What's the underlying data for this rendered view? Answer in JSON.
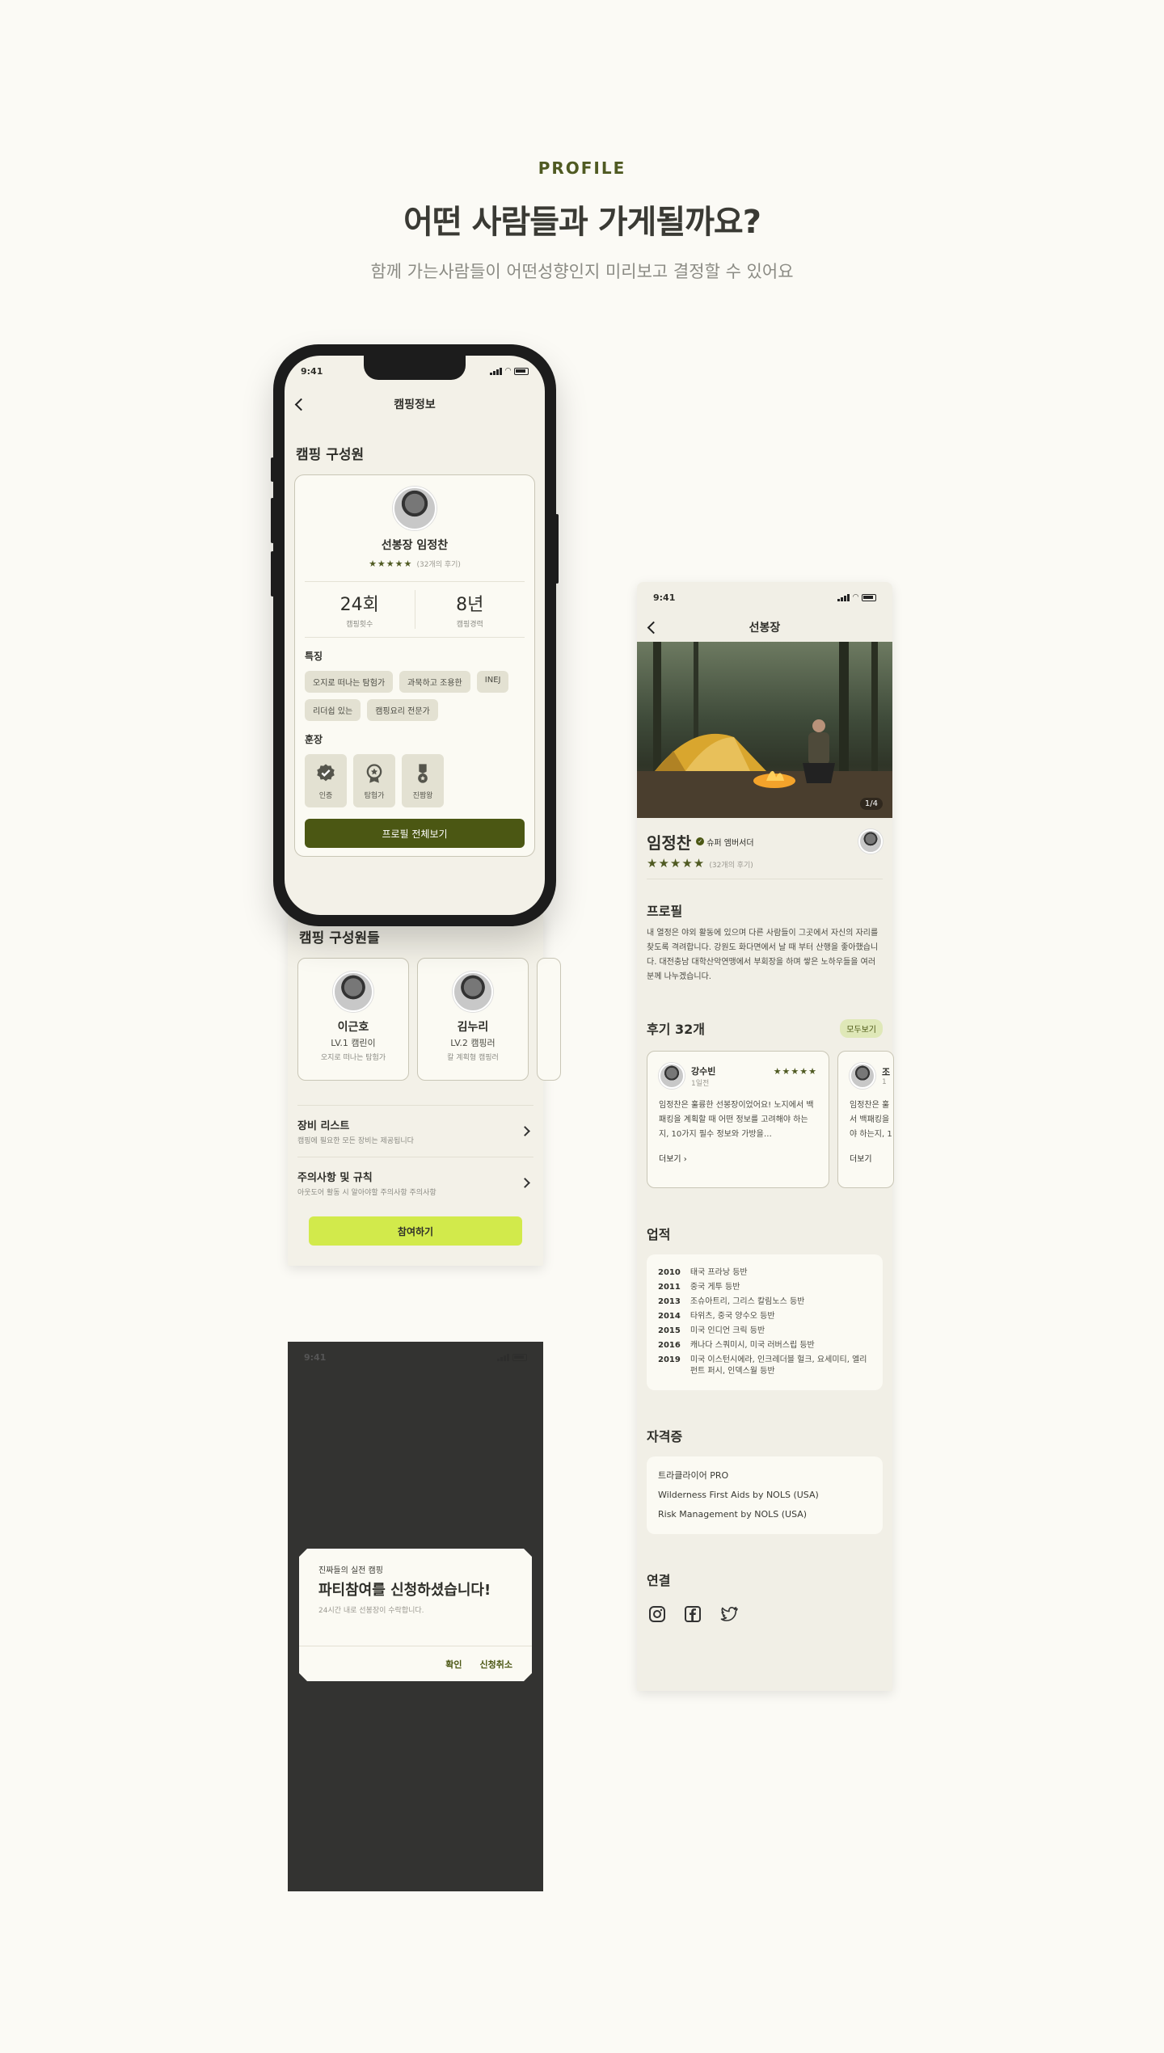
{
  "hero": {
    "kicker": "PROFILE",
    "title": "어떤 사람들과 가게될까요?",
    "subtitle": "함께 가는사람들이 어떤성향인지 미리보고 결정할 수 있어요"
  },
  "status_time": "9:41",
  "camp_info": {
    "nav_title": "캠핑정보",
    "section_title": "캠핑 구성원",
    "leader": {
      "name": "선봉장 임정찬",
      "stars": "★★★★★",
      "review_count": "(32개의 후기)"
    },
    "stats": [
      {
        "value": "24회",
        "label": "캠핑횟수"
      },
      {
        "value": "8년",
        "label": "캠핑경력"
      }
    ],
    "traits_title": "특징",
    "traits": [
      "오지로 떠나는 탐험가",
      "과묵하고 조용한",
      "INEJ",
      "리더쉽 있는",
      "캠핑요리 전문가"
    ],
    "medals_title": "훈장",
    "medals": [
      {
        "icon": "verified-icon",
        "label": "인증"
      },
      {
        "icon": "explorer-medal-icon",
        "label": "탐험가"
      },
      {
        "icon": "ribbon-medal-icon",
        "label": "진짬왕"
      }
    ],
    "full_profile_button": "프로필 전체보기",
    "members_title": "캠핑 구성원들",
    "members": [
      {
        "name": "이근호",
        "level": "LV.1 캠린이",
        "desc": "오지로 떠나는 탐험가"
      },
      {
        "name": "김누리",
        "level": "LV.2 캠핑러",
        "desc": "칼 계획형 캠핑러"
      }
    ],
    "list": [
      {
        "title": "장비 리스트",
        "sub": "캠핑에 필요한 모든 장비는 제공됩니다"
      },
      {
        "title": "주의사항 및 규칙",
        "sub": "아웃도어 활동 시 알아야할 주의사항 주의사항"
      }
    ],
    "join_button": "참여하기"
  },
  "modal": {
    "kicker": "진짜들의 실전 캠핑",
    "title": "파티참여를 신청하셨습니다!",
    "sub": "24시간 내로 선봉장이 수락합니다.",
    "confirm": "확인",
    "cancel": "신청취소"
  },
  "profile": {
    "nav_title": "선봉장",
    "photo_counter": "1/4",
    "name": "임정찬",
    "badge": "슈퍼 엠버서더",
    "stars": "★★★★★",
    "review_count": "(32개의 후기)",
    "profile_title": "프로필",
    "profile_text": "내 열정은 야외 활동에 있으며 다른 사람들이 그곳에서 자신의 자리를 찾도록 격려합니다. 강원도 화다면에서 날 때 부터 산행을 좋아했습니다. 대전충남 대학산악연맹에서 부회장을 하며 쌓은 노하우들을 여러분께 나누겠습니다.",
    "reviews_title": "후기 32개",
    "see_all": "모두보기",
    "reviews": [
      {
        "name": "강수빈",
        "time": "1일전",
        "stars": "★★★★★",
        "text": "임정찬은 훌륭한 선봉장이었어요! 노지에서 백패킹을 계획할 때 어떤 정보를 고려해야 하는지, 10가지 필수 정보와 가방을…",
        "more": "더보기"
      },
      {
        "name": "조",
        "time": "1",
        "stars": "",
        "text": "임정찬은 훌 서 백패킹을 야 하는지, 1",
        "more": "더보기"
      }
    ],
    "achievements_title": "업적",
    "achievements": [
      {
        "year": "2010",
        "text": "태국 프라낭 등반"
      },
      {
        "year": "2011",
        "text": "중국 게투 등반"
      },
      {
        "year": "2013",
        "text": "조슈아트리, 그리스 칼림노스 등반"
      },
      {
        "year": "2014",
        "text": "타위츠, 중국 양수오 등반"
      },
      {
        "year": "2015",
        "text": "미국 인디언 크릭 등반"
      },
      {
        "year": "2016",
        "text": "캐나다 스쿼미시, 미국 러버스립 등반"
      },
      {
        "year": "2019",
        "text": "미국 이스턴시에라, 인크레더블 헐크, 요세미티, 엘리펀트 퍼시, 인덱스월 등반"
      }
    ],
    "certs_title": "자격증",
    "certs": [
      "트라클라이어 PRO",
      "Wilderness First Aids by NOLS (USA)",
      "Risk Management by NOLS (USA)"
    ],
    "connect_title": "연결",
    "socials": [
      "instagram-icon",
      "facebook-icon",
      "twitter-icon"
    ]
  }
}
